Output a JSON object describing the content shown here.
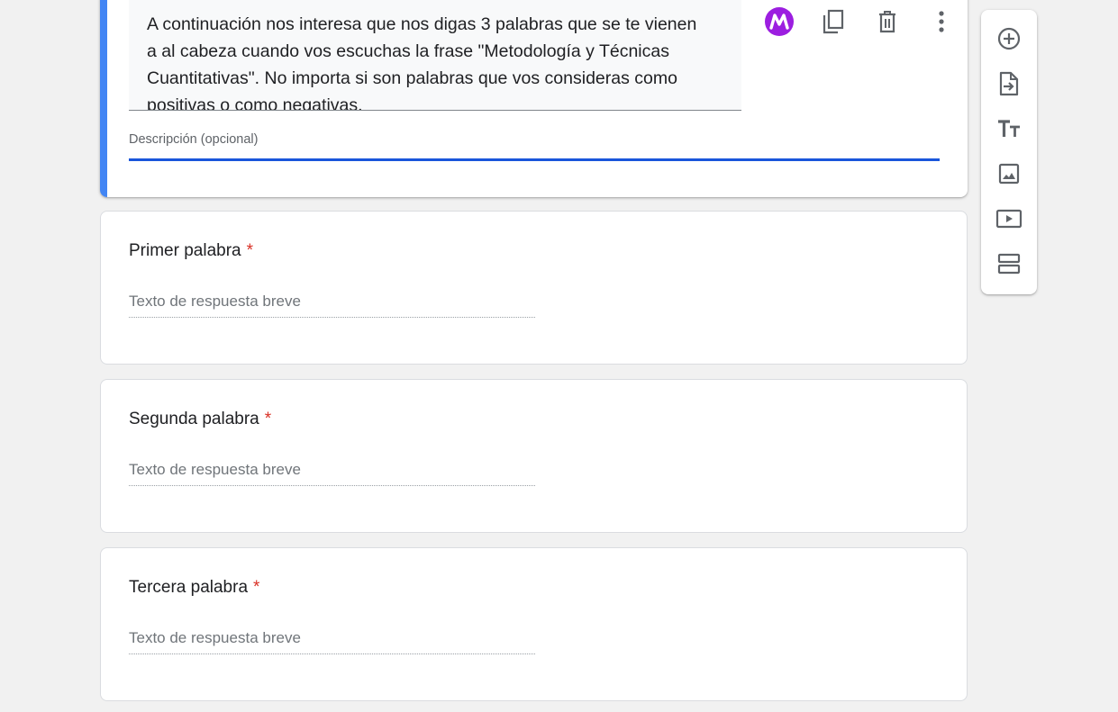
{
  "section": {
    "description_text": "A continuación nos interesa que nos digas 3 palabras que se te vienen a al cabeza cuando vos escuchas la frase \"Metodología y Técnicas Cuantitativas\". No importa si son palabras que vos consideras como positivas o como negativas.",
    "description_label": "Descripción (opcional)",
    "accent_color": "#4285f4",
    "underline_color": "#1a56db",
    "actions": [
      {
        "icon": "addon-logo-icon"
      },
      {
        "icon": "copy-icon"
      },
      {
        "icon": "delete-icon"
      },
      {
        "icon": "more-vert-icon"
      }
    ]
  },
  "questions": [
    {
      "title": "Primer palabra",
      "required_mark": "*",
      "placeholder": "Texto de respuesta breve"
    },
    {
      "title": "Segunda palabra",
      "required_mark": "*",
      "placeholder": "Texto de respuesta breve"
    },
    {
      "title": "Tercera palabra",
      "required_mark": "*",
      "placeholder": "Texto de respuesta breve"
    }
  ],
  "toolbar": {
    "items": [
      {
        "icon": "add-question-icon"
      },
      {
        "icon": "import-questions-icon"
      },
      {
        "icon": "add-title-icon"
      },
      {
        "icon": "add-image-icon"
      },
      {
        "icon": "add-video-icon"
      },
      {
        "icon": "add-section-icon"
      }
    ]
  },
  "colors": {
    "background": "#f1f1f1",
    "required": "#d93025",
    "logo": "#9c1ee0"
  }
}
